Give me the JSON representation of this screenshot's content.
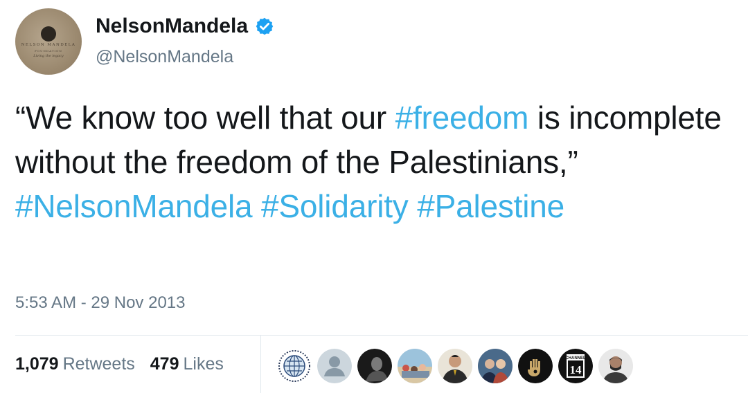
{
  "user": {
    "display_name": "NelsonMandela",
    "handle": "@NelsonMandela",
    "verified": true,
    "avatar_text": [
      "NELSON MANDELA",
      "FOUNDATION",
      "Living the legacy"
    ]
  },
  "tweet": {
    "segments": [
      {
        "text": "“We know too well that our ",
        "type": "text"
      },
      {
        "text": "#freedom",
        "type": "hashtag"
      },
      {
        "text": " is incomplete without the freedom of the Palestinians,” ",
        "type": "text"
      },
      {
        "text": "#NelsonMandela",
        "type": "hashtag"
      },
      {
        "text": " ",
        "type": "text"
      },
      {
        "text": "#Solidarity",
        "type": "hashtag"
      },
      {
        "text": " ",
        "type": "text"
      },
      {
        "text": "#Palestine",
        "type": "hashtag"
      }
    ],
    "timestamp": "5:53 AM - 29 Nov 2013"
  },
  "stats": {
    "retweets_count": "1,079",
    "retweets_label": "Retweets",
    "likes_count": "479",
    "likes_label": "Likes"
  },
  "likers": [
    {
      "icon": "globe-seal-avatar-icon"
    },
    {
      "icon": "default-user-avatar-icon"
    },
    {
      "icon": "dark-portrait-avatar-icon"
    },
    {
      "icon": "beach-crowd-avatar-icon"
    },
    {
      "icon": "man-in-suit-avatar-icon"
    },
    {
      "icon": "group-photo-avatar-icon"
    },
    {
      "icon": "hamsa-hand-avatar-icon"
    },
    {
      "icon": "channel-14-avatar-icon",
      "text": [
        "CHANNEL",
        "14"
      ]
    },
    {
      "icon": "bearded-man-avatar-icon"
    }
  ],
  "colors": {
    "hashtag": "#3bb0e6",
    "verified": "#1da1f2",
    "secondary_text": "#657786"
  }
}
